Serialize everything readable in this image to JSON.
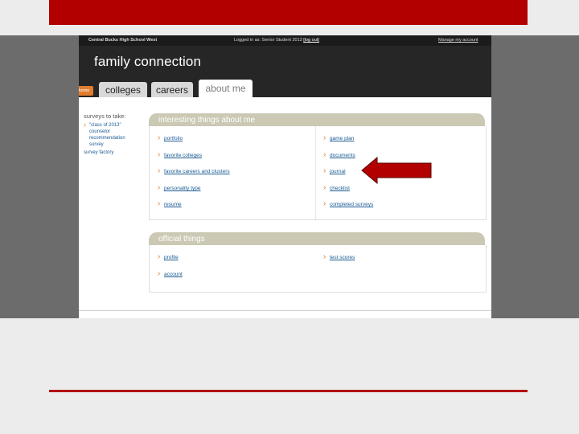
{
  "header": {
    "school": "Central Bucks High School West",
    "logged_prefix": "Logged in as: Senior Student 2013",
    "logout_label": "[log out]",
    "manage_account": "Manage my account",
    "brand": "family connection"
  },
  "tabs": {
    "home": "home",
    "colleges": "colleges",
    "careers": "careers",
    "about_me": "about me"
  },
  "sidebar": {
    "title": "surveys to take:",
    "item_line1": "\"class of 2013\"",
    "item_line2": "counselor",
    "item_line3": "recommendation",
    "item_line4": "survey",
    "survey_factory": "survey factory"
  },
  "panel1": {
    "title": "interesting things about me",
    "left": [
      "portfolio",
      "favorite colleges",
      "favorite careers and clusters",
      "personality type",
      "resume"
    ],
    "right": [
      "game plan",
      "documents",
      "journal",
      "checklist",
      "completed surveys"
    ]
  },
  "panel2": {
    "title": "official things",
    "left": [
      "profile",
      "account"
    ],
    "right": [
      "test scores"
    ]
  },
  "colors": {
    "accent_red": "#b20000",
    "header_dark": "#262626",
    "panel_head": "#cbc8b4",
    "link": "#1a5a93",
    "bullet_orange": "#e07e2e"
  },
  "icons": {
    "arrow": "red-left-arrow"
  }
}
